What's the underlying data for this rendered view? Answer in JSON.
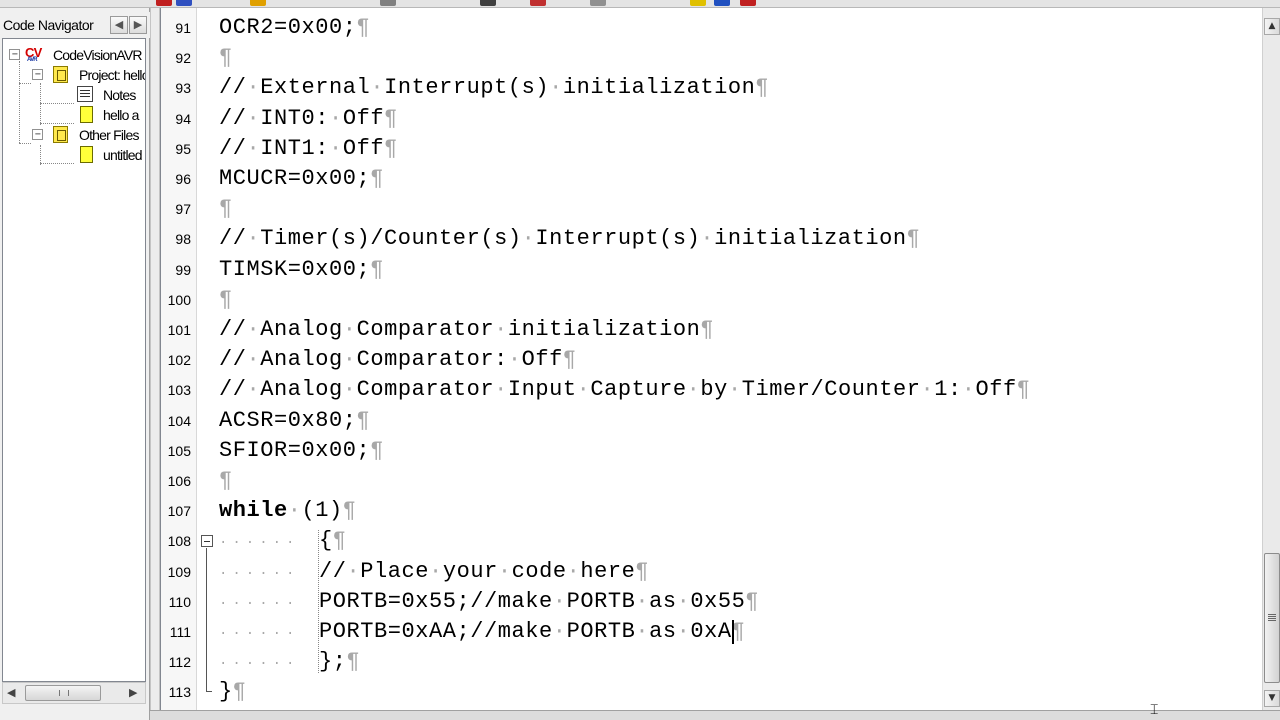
{
  "navigator": {
    "title": "Code Navigator",
    "back_arrow": "◀",
    "forward_arrow": "▶",
    "tree": [
      {
        "label": "CodeVisionAVR",
        "icon": "codevision-icon",
        "expanded": true
      },
      {
        "label": "Project: hello",
        "icon": "project-folder-icon",
        "expanded": true
      },
      {
        "label": "Notes",
        "icon": "notes-icon"
      },
      {
        "label": "hello a",
        "icon": "file-icon"
      },
      {
        "label": "Other Files",
        "icon": "folder-icon",
        "expanded": true
      },
      {
        "label": "untitled",
        "icon": "file-icon"
      }
    ],
    "expand_symbol": "−",
    "cv_logo_text": "CV",
    "cv_logo_sub": "AVR",
    "scroll_left": "◀",
    "scroll_right": "▶"
  },
  "editor": {
    "lines": [
      {
        "no": "91",
        "text": "OCR2=0x00;"
      },
      {
        "no": "92",
        "text": ""
      },
      {
        "no": "93",
        "text": "// External Interrupt(s) initialization"
      },
      {
        "no": "94",
        "text": "// INT0: Off"
      },
      {
        "no": "95",
        "text": "// INT1: Off"
      },
      {
        "no": "96",
        "text": "MCUCR=0x00;"
      },
      {
        "no": "97",
        "text": ""
      },
      {
        "no": "98",
        "text": "// Timer(s)/Counter(s) Interrupt(s) initialization"
      },
      {
        "no": "99",
        "text": "TIMSK=0x00;"
      },
      {
        "no": "100",
        "text": ""
      },
      {
        "no": "101",
        "text": "// Analog Comparator initialization"
      },
      {
        "no": "102",
        "text": "// Analog Comparator: Off"
      },
      {
        "no": "103",
        "text": "// Analog Comparator Input Capture by Timer/Counter 1: Off"
      },
      {
        "no": "104",
        "text": "ACSR=0x80;"
      },
      {
        "no": "105",
        "text": "SFIOR=0x00;"
      },
      {
        "no": "106",
        "text": ""
      },
      {
        "no": "107",
        "text": "while (1)",
        "keyword": "while"
      },
      {
        "no": "108",
        "text": "{",
        "indent": true,
        "fold": true
      },
      {
        "no": "109",
        "text": "// Place your code here",
        "indent": true
      },
      {
        "no": "110",
        "text": "PORTB=0x55;//make PORTB as 0x55",
        "indent": true
      },
      {
        "no": "111",
        "text": "PORTB=0xAA;//make PORTB as 0xA",
        "indent": true,
        "caret": true
      },
      {
        "no": "112",
        "text": "};",
        "indent": true
      },
      {
        "no": "113",
        "text": "}"
      }
    ],
    "pilcrow": "¶",
    "space_marker": "·",
    "indent_marker": "······",
    "first_visible_line": 91,
    "caret_line": 111,
    "caret_column": 31
  },
  "scrollbar": {
    "up_arrow": "▲",
    "down_arrow": "▼",
    "position": 0.78
  },
  "colors": {
    "editor_bg": "#ffffff",
    "whitespace_marks": "#a8a8a8",
    "text": "#000000"
  }
}
